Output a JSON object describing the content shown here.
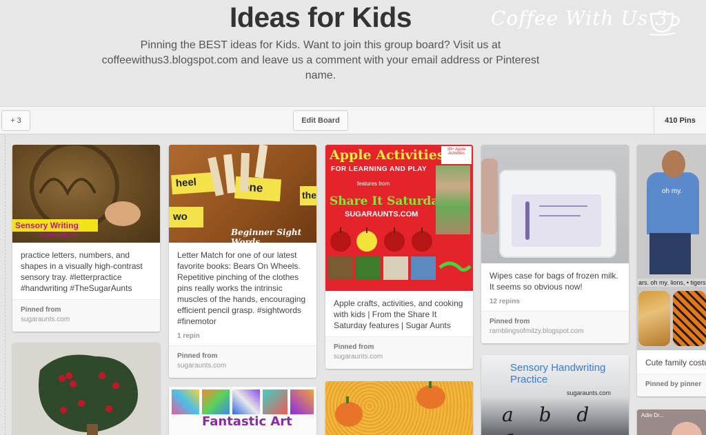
{
  "header": {
    "title": "Ideas for Kids",
    "description": "Pinning the BEST ideas for Kids. Want to join this group board? Visit us at coffeewithus3.blogspot.com and leave us a comment with your email address or Pinterest name.",
    "watermark": "Coffee With Us 3"
  },
  "toolbar": {
    "collaborators_label": "+ 3",
    "edit_label": "Edit Board",
    "pins_count": "410 Pins"
  },
  "pins": [
    {
      "image_text": "Sensory Writing",
      "image_subtext": "sugaraunts.com",
      "description": "practice letters, numbers, and shapes in a visually high-contrast sensory tray. #letterpractice #handwriting #TheSugarAunts",
      "pinned_from_label": "Pinned from",
      "source": "sugaraunts.com"
    },
    {
      "image_words": [
        "heel",
        "one",
        "wo",
        "the"
      ],
      "image_text": "Beginner Sight Words",
      "description": "Letter Match for one of our latest favorite books: Bears On Wheels. Repetitive pinching of the clothes pins really works the intrinsic muscles of the hands, encouraging efficient pencil grasp. #sightwords #finemotor",
      "repins": "1 repin",
      "pinned_from_label": "Pinned from",
      "source": "sugaraunts.com"
    },
    {
      "image_title": "Apple Activities",
      "image_subtitle": "FOR LEARNING AND PLAY",
      "image_features": "features from",
      "image_share": "Share It Saturday",
      "image_site": "SUGARAUNTS.COM",
      "image_badge": "30+ Apple Activities",
      "description": "Apple crafts, activities, and cooking with kids | From the Share It Saturday features | Sugar Aunts",
      "pinned_from_label": "Pinned from",
      "source": "sugaraunts.com"
    },
    {
      "description": "Wipes case for bags of frozen milk. It seems so obvious now!",
      "repins": "12 repins",
      "pinned_from_label": "Pinned from",
      "source": "ramblingsofmitzy.blogspot.com"
    },
    {
      "image_shirt": "oh my.",
      "image_caption": "ars. oh my.  lions, • tigers",
      "description": "Cute family costu",
      "pinned_by": "Pinned by pinner"
    },
    {
      "image_title": "Fantastic Art"
    },
    {
      "image_title": "Sensory Handwriting Practice",
      "image_site": "sugaraunts.com",
      "image_letters": "a b d q"
    },
    {
      "image_text": "Adie Dr..."
    }
  ]
}
